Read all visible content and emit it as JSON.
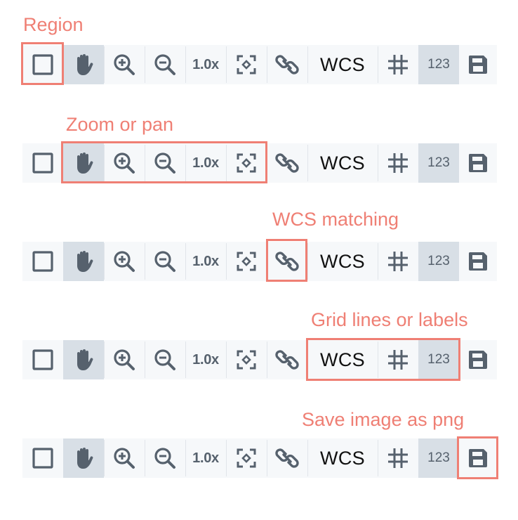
{
  "colors": {
    "highlight": "#ef7f74",
    "toolbar_bg": "#f6f8fa",
    "active_bg": "#d8dfe6",
    "icon": "#56616d"
  },
  "toolbar": {
    "buttons": [
      {
        "id": "region",
        "icon": "square-icon",
        "active": false
      },
      {
        "id": "pan",
        "icon": "hand-icon",
        "active": true
      },
      {
        "id": "zoom-in",
        "icon": "zoom-in-icon",
        "active": false
      },
      {
        "id": "zoom-out",
        "icon": "zoom-out-icon",
        "active": false
      },
      {
        "id": "zoom-reset",
        "label": "1.0x",
        "active": false
      },
      {
        "id": "zoom-fit",
        "icon": "fit-frame-icon",
        "active": false
      },
      {
        "id": "wcs-match",
        "icon": "link-icon",
        "active": false
      },
      {
        "id": "coord-system",
        "label": "WCS",
        "active": false
      },
      {
        "id": "grid-lines",
        "icon": "grid-icon",
        "active": false
      },
      {
        "id": "grid-labels",
        "label": "123",
        "active": true
      },
      {
        "id": "save",
        "icon": "save-icon",
        "active": false
      }
    ]
  },
  "rows": [
    {
      "caption": "Region"
    },
    {
      "caption": "Zoom or pan"
    },
    {
      "caption": "WCS matching"
    },
    {
      "caption": "Grid lines or labels"
    },
    {
      "caption": "Save image as png"
    }
  ]
}
